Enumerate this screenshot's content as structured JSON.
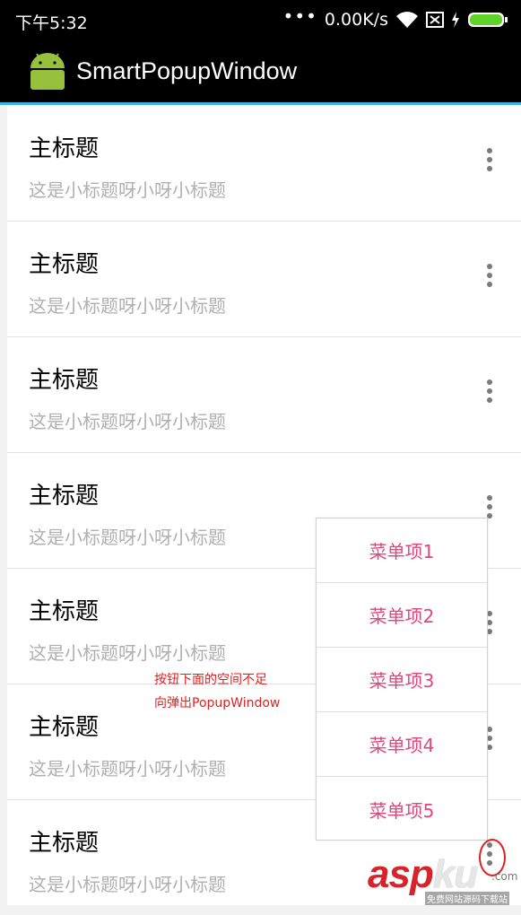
{
  "statusbar": {
    "time": "下午5:32",
    "dots": "•••",
    "speed": "0.00K/s",
    "icons": [
      "wifi-icon",
      "sim-off-icon",
      "charging-icon",
      "battery-icon"
    ]
  },
  "actionbar": {
    "title": "SmartPopupWindow",
    "logo_icon": "android-robot-icon"
  },
  "colors": {
    "accent_line": "#33b5e5",
    "menu_text": "#e0457b",
    "note_text": "#e02020",
    "android_green": "#97c03d"
  },
  "list": {
    "rows": [
      {
        "title": "主标题",
        "subtitle": "这是小标题呀小呀小标题"
      },
      {
        "title": "主标题",
        "subtitle": "这是小标题呀小呀小标题"
      },
      {
        "title": "主标题",
        "subtitle": "这是小标题呀小呀小标题"
      },
      {
        "title": "主标题",
        "subtitle": "这是小标题呀小呀小标题"
      },
      {
        "title": "主标题",
        "subtitle": "这是小标题呀小呀小标题"
      },
      {
        "title": "主标题",
        "subtitle": "这是小标题呀小呀小标题"
      },
      {
        "title": "主标题",
        "subtitle": "这是小标题呀小呀小标题"
      }
    ]
  },
  "popup": {
    "items": [
      "菜单项1",
      "菜单项2",
      "菜单项3",
      "菜单项4",
      "菜单项5"
    ]
  },
  "annotation": {
    "line1": "按钮下面的空间不足",
    "line2": "向弹出PopupWindow"
  },
  "watermark": {
    "brand_a": "asp",
    "brand_b": "ku",
    "domain": ".com",
    "tagline": "免费网站源码下载站"
  }
}
